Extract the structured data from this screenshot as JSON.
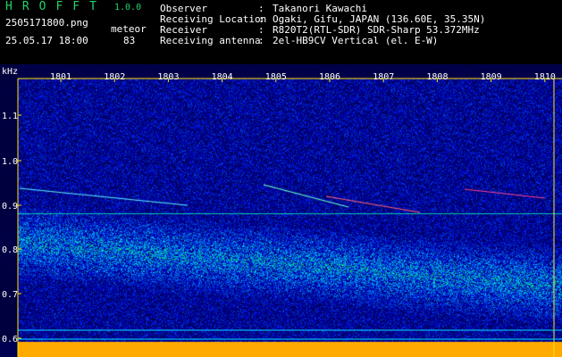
{
  "header": {
    "app_title": "HROFFT",
    "app_version": "1.0.0",
    "filename": "2505171800.png",
    "meteor_label": "meteor",
    "timestamp": "25.05.17 18:00",
    "meteor_count": "83",
    "info": [
      {
        "key": "Observer",
        "sep": ":",
        "value": "Takanori Kawachi"
      },
      {
        "key": "Receiving Location",
        "sep": ":",
        "value": "Ogaki, Gifu, JAPAN (136.60E, 35.35N)"
      },
      {
        "key": "Receiver",
        "sep": ":",
        "value": "R820T2(RTL-SDR) SDR-Sharp 53.372MHz"
      },
      {
        "key": "Receiving antenna",
        "sep": ":",
        "value": "2el-HB9CV Vertical (el. E-W)"
      }
    ]
  },
  "axis": {
    "unit": "kHz",
    "freq_ticks": [
      "1.1",
      "1.0",
      "0.9",
      "0.8",
      "0.7",
      "0.6"
    ],
    "time_ticks": [
      "1801",
      "1802",
      "1803",
      "1804",
      "1805",
      "1806",
      "1807",
      "1808",
      "1809",
      "1810"
    ]
  },
  "colors": {
    "background": "#000000",
    "waterfall_base": "#0a1a7a",
    "title_green": "#21d36b",
    "axis_yellow": "#ffe600",
    "grid_cyan": "#00d8ff"
  }
}
